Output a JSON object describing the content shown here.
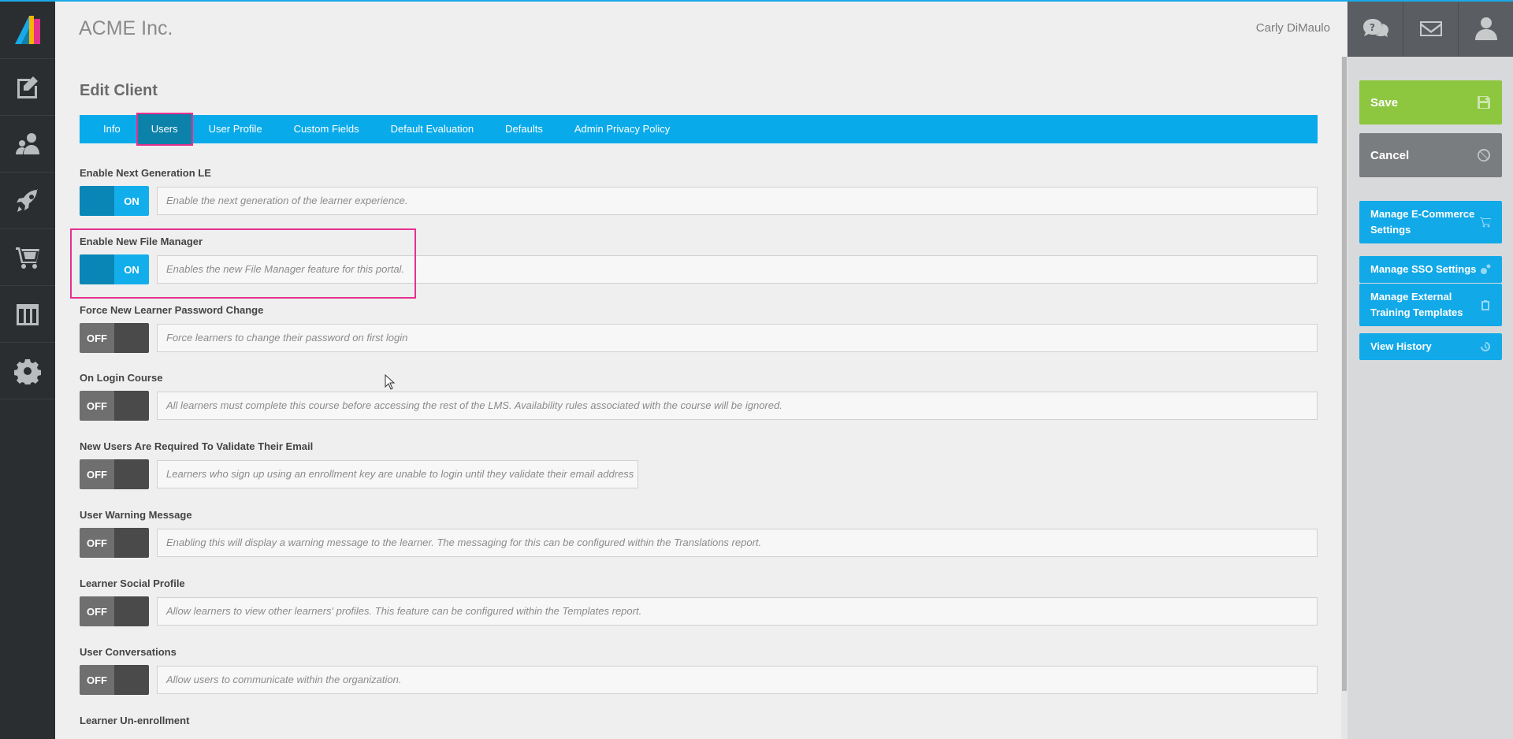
{
  "header": {
    "company": "ACME Inc.",
    "user_name": "Carly DiMaulo",
    "icons": [
      "help-chat-icon",
      "mail-icon",
      "user-icon"
    ]
  },
  "sidebar": {
    "icons": [
      "logo",
      "edit-icon",
      "users-icon",
      "rocket-icon",
      "cart-icon",
      "columns-icon",
      "gear-icon"
    ]
  },
  "page": {
    "title": "Edit Client"
  },
  "tabs": [
    {
      "label": "Info",
      "active": false
    },
    {
      "label": "Users",
      "active": true
    },
    {
      "label": "User Profile",
      "active": false
    },
    {
      "label": "Custom Fields",
      "active": false
    },
    {
      "label": "Default Evaluation",
      "active": false
    },
    {
      "label": "Defaults",
      "active": false
    },
    {
      "label": "Admin Privacy Policy",
      "active": false
    }
  ],
  "settings": [
    {
      "label": "Enable Next Generation LE",
      "state": "ON",
      "description": "Enable the next generation of the learner experience."
    },
    {
      "label": "Enable New File Manager",
      "state": "ON",
      "description": "Enables the new File Manager feature for this portal."
    },
    {
      "label": "Force New Learner Password Change",
      "state": "OFF",
      "description": "Force learners to change their password on first login"
    },
    {
      "label": "On Login Course",
      "state": "OFF",
      "description": "All learners must complete this course before accessing the rest of the LMS. Availability rules associated with the course will be ignored."
    },
    {
      "label": "New Users Are Required To Validate Their Email",
      "state": "OFF",
      "description": "Learners who sign up using an enrollment key are unable to login until they validate their email address"
    },
    {
      "label": "User Warning Message",
      "state": "OFF",
      "description": "Enabling this will display a warning message to the learner. The messaging for this can be configured within the Translations report."
    },
    {
      "label": "Learner Social Profile",
      "state": "OFF",
      "description": "Allow learners to view other learners' profiles. This feature can be configured within the Templates report."
    },
    {
      "label": "User Conversations",
      "state": "OFF",
      "description": "Allow users to communicate within the organization."
    },
    {
      "label": "Learner Un-enrollment",
      "state": "",
      "description": ""
    }
  ],
  "actions": {
    "save": "Save",
    "cancel": "Cancel",
    "links": [
      {
        "label": "Manage E-Commerce Settings",
        "icon": "cart-icon"
      },
      {
        "label": "Manage SSO Settings",
        "icon": "gears-icon"
      },
      {
        "label": "Manage External Training Templates",
        "icon": "clipboard-icon"
      },
      {
        "label": "View History",
        "icon": "history-icon"
      }
    ]
  },
  "colors": {
    "tab_bar": "#09aaea",
    "tab_active": "#0c81a9",
    "highlight": "#e5308e",
    "save": "#8dc63f",
    "cancel": "#7a7d80",
    "action_link": "#12a9e8"
  }
}
